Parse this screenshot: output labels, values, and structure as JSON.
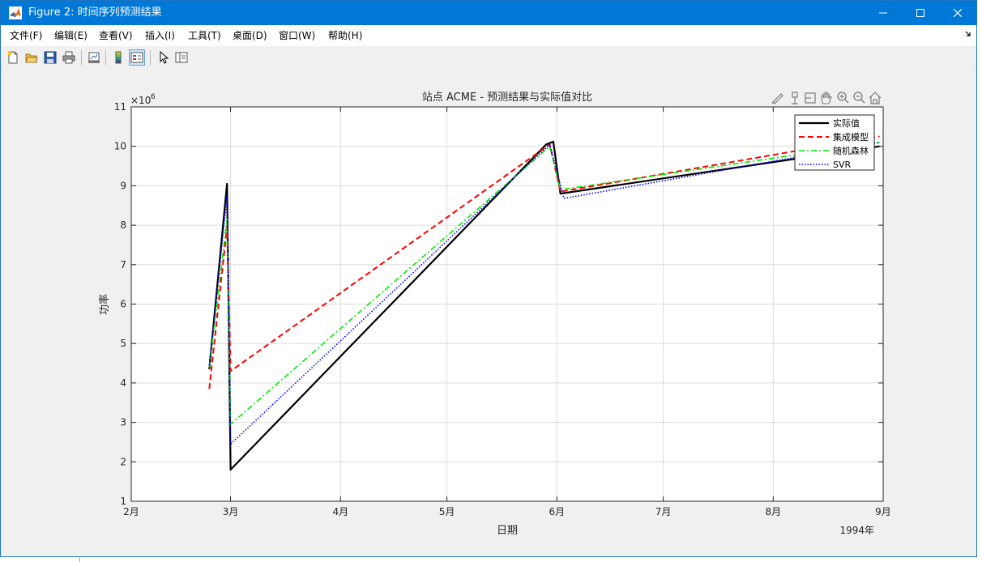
{
  "window": {
    "title": "Figure 2: 时间序列预测结果",
    "controls": {
      "minimize": "minimize",
      "maximize": "maximize",
      "close": "close"
    }
  },
  "menubar": {
    "items": [
      {
        "label": "文件(F)"
      },
      {
        "label": "编辑(E)"
      },
      {
        "label": "查看(V)"
      },
      {
        "label": "插入(I)"
      },
      {
        "label": "工具(T)"
      },
      {
        "label": "桌面(D)"
      },
      {
        "label": "窗口(W)"
      },
      {
        "label": "帮助(H)"
      }
    ]
  },
  "toolbar": {
    "buttons": [
      "new-figure-icon",
      "open-file-icon",
      "save-icon",
      "print-icon",
      "link-plot-icon",
      "colorbar-icon",
      "legend-icon",
      "pointer-icon",
      "property-editor-icon"
    ]
  },
  "axes_toolbar": {
    "buttons": [
      "brush-icon",
      "data-tips-icon",
      "rotate-icon",
      "pan-icon",
      "zoom-in-icon",
      "zoom-out-icon",
      "home-icon"
    ]
  },
  "chart_data": {
    "type": "line",
    "title": "站点 ACME - 预测结果与实际值对比",
    "xlabel": "日期",
    "ylabel": "功率",
    "x_tick_labels": [
      "2月",
      "3月",
      "4月",
      "5月",
      "6月",
      "7月",
      "8月",
      "9月"
    ],
    "x_year_label": "1994年",
    "y_exponent_label": "×10",
    "y_exponent_power": "6",
    "y_ticks": [
      1,
      2,
      3,
      4,
      5,
      6,
      7,
      8,
      9,
      10,
      11
    ],
    "ylim": [
      1,
      11
    ],
    "xlim": [
      "1994-02-01",
      "1994-09-01"
    ],
    "grid": true,
    "legend_position": "top-right",
    "series": [
      {
        "name": "实际值",
        "color": "#000000",
        "style": "solid",
        "points": [
          [
            "1994-02-23",
            4.35
          ],
          [
            "1994-02-28",
            9.05
          ],
          [
            "1994-03-01",
            1.8
          ],
          [
            "1994-05-29",
            10.05
          ],
          [
            "1994-05-31",
            10.12
          ],
          [
            "1994-06-02",
            8.8
          ],
          [
            "1994-08-31",
            10.0
          ]
        ]
      },
      {
        "name": "集成模型",
        "color": "#ff0000",
        "style": "dashed",
        "points": [
          [
            "1994-02-23",
            3.85
          ],
          [
            "1994-02-28",
            7.95
          ],
          [
            "1994-03-01",
            4.3
          ],
          [
            "1994-05-30",
            10.05
          ],
          [
            "1994-06-02",
            8.85
          ],
          [
            "1994-08-31",
            10.25
          ]
        ]
      },
      {
        "name": "随机森林",
        "color": "#00ee00",
        "style": "dashdot",
        "points": [
          [
            "1994-02-23",
            4.4
          ],
          [
            "1994-02-28",
            8.15
          ],
          [
            "1994-03-01",
            2.95
          ],
          [
            "1994-05-30",
            10.0
          ],
          [
            "1994-06-02",
            8.9
          ],
          [
            "1994-08-31",
            10.1
          ]
        ]
      },
      {
        "name": "SVR",
        "color": "#0000ff",
        "style": "dotted",
        "points": [
          [
            "1994-02-23",
            4.45
          ],
          [
            "1994-02-28",
            8.75
          ],
          [
            "1994-03-01",
            2.45
          ],
          [
            "1994-05-30",
            10.05
          ],
          [
            "1994-06-03",
            8.68
          ],
          [
            "1994-08-31",
            10.1
          ]
        ]
      }
    ]
  }
}
